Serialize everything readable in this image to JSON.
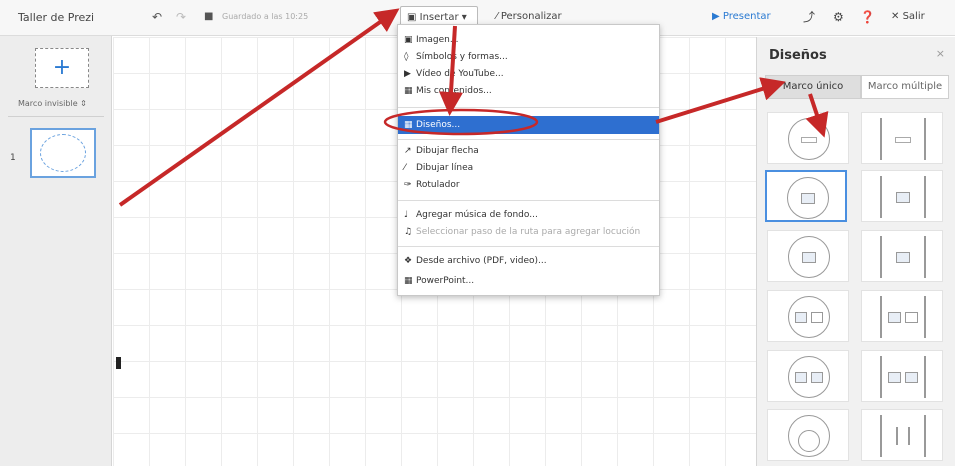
{
  "app": {
    "title": "Taller de Prezi",
    "saved_text": "Guardado a las 10:25"
  },
  "toolbar": {
    "undo_icon": "undo-icon",
    "redo_icon": "redo-icon",
    "save_icon": "save-icon",
    "insert_label": "Insertar ▾",
    "customize_label": "Personalizar",
    "present_label": "Presentar",
    "exit_label": "Salir"
  },
  "left_panel": {
    "frame_type": "Marco invisible ⇕",
    "slide_number": "1"
  },
  "insert_menu": {
    "items": [
      {
        "icon": "image-icon",
        "label": "Imagen..."
      },
      {
        "icon": "symbol-icon",
        "label": "Símbolos y formas..."
      },
      {
        "icon": "youtube-icon",
        "label": "Vídeo de YouTube..."
      },
      {
        "icon": "content-icon",
        "label": "Mis contenidos..."
      },
      {
        "icon": "layouts-icon",
        "label": "Diseños..."
      },
      {
        "icon": "arrow-icon",
        "label": "Dibujar flecha"
      },
      {
        "icon": "line-icon",
        "label": "Dibujar línea"
      },
      {
        "icon": "marker-icon",
        "label": "Rotulador"
      },
      {
        "icon": "music-icon",
        "label": "Agregar música de fondo..."
      },
      {
        "icon": "voice-icon",
        "label": "Seleccionar paso de la ruta para agregar locución"
      },
      {
        "icon": "file-icon",
        "label": "Desde archivo (PDF, video)..."
      },
      {
        "icon": "powerpoint-icon",
        "label": "PowerPoint..."
      }
    ]
  },
  "right_panel": {
    "title": "Diseños",
    "close": "×",
    "tabs": [
      {
        "label": "Marco único"
      },
      {
        "label": "Marco múltiple"
      }
    ]
  },
  "colors": {
    "accent": "#2e6fd0",
    "annotation": "#c62828"
  }
}
